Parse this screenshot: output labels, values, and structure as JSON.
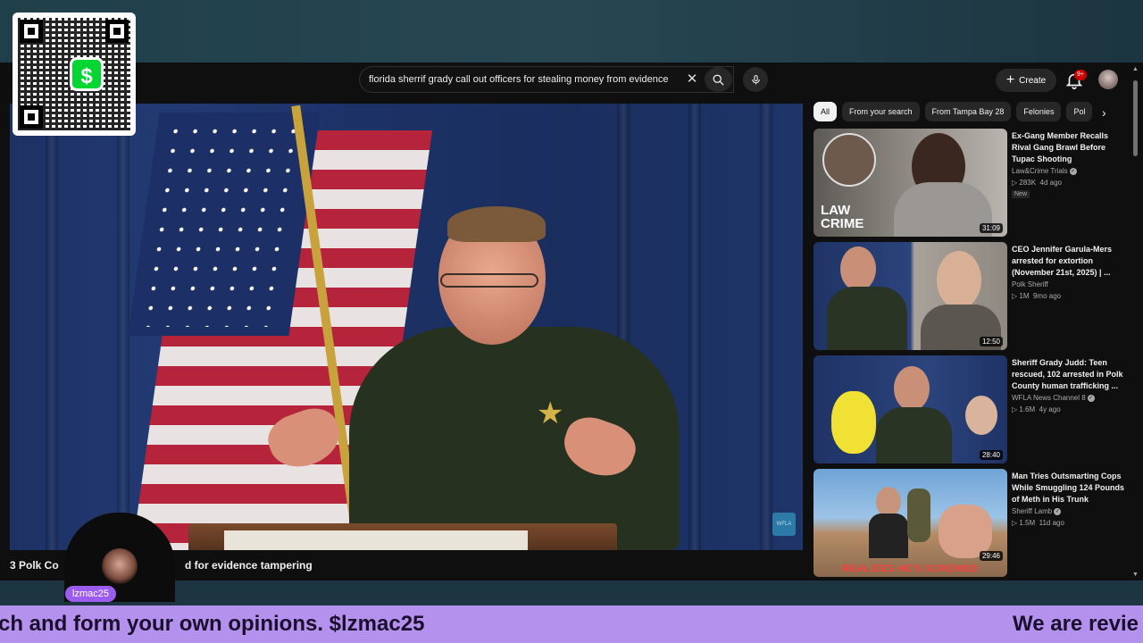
{
  "search": {
    "query": "florida sherrif grady call out officers for stealing money from evidence"
  },
  "header": {
    "create_label": "Create",
    "notification_count": "9+"
  },
  "video": {
    "title_start": "3 Polk Co",
    "title_end": "d for evidence tampering",
    "bug_text": "WFLA"
  },
  "chips": [
    "All",
    "From your search",
    "From Tampa Bay 28",
    "Felonies",
    "Pol"
  ],
  "recommendations": [
    {
      "title": "Ex-Gang Member Recalls Rival Gang Brawl Before Tupac Shooting",
      "channel": "Law&Crime Trials",
      "verified": true,
      "views": "283K",
      "age": "4d ago",
      "new_badge": "New",
      "duration": "31:09",
      "thumb_text": "LAW CRIME"
    },
    {
      "title": "CEO Jennifer Garula-Mers arrested for extortion (November 21st, 2025) | ...",
      "channel": "Polk Sheriff",
      "verified": false,
      "views": "1M",
      "age": "9mo ago",
      "duration": "12:50"
    },
    {
      "title": "Sheriff Grady Judd: Teen rescued, 102 arrested in Polk County human trafficking ...",
      "channel": "WFLA News Channel 8",
      "verified": true,
      "views": "1.6M",
      "age": "4y ago",
      "duration": "28:40"
    },
    {
      "title": "Man Tries Outsmarting Cops While Smuggling 124 Pounds of Meth in His Trunk",
      "channel": "Sheriff Lamb",
      "verified": true,
      "views": "1.5M",
      "age": "11d ago",
      "duration": "29:46",
      "thumb_text": "REALIZES HE'S SCREWED"
    }
  ],
  "overlay": {
    "streamer_name": "lzmac25",
    "cashapp_symbol": "$",
    "ticker_left": "ch and form your own opinions. $lzmac25",
    "ticker_right": "We are revie"
  },
  "colors": {
    "ticker_bg": "#b591ee",
    "name_pill": "#9d5cf0",
    "cashapp_green": "#00d632",
    "notification_red": "#cc0000"
  }
}
